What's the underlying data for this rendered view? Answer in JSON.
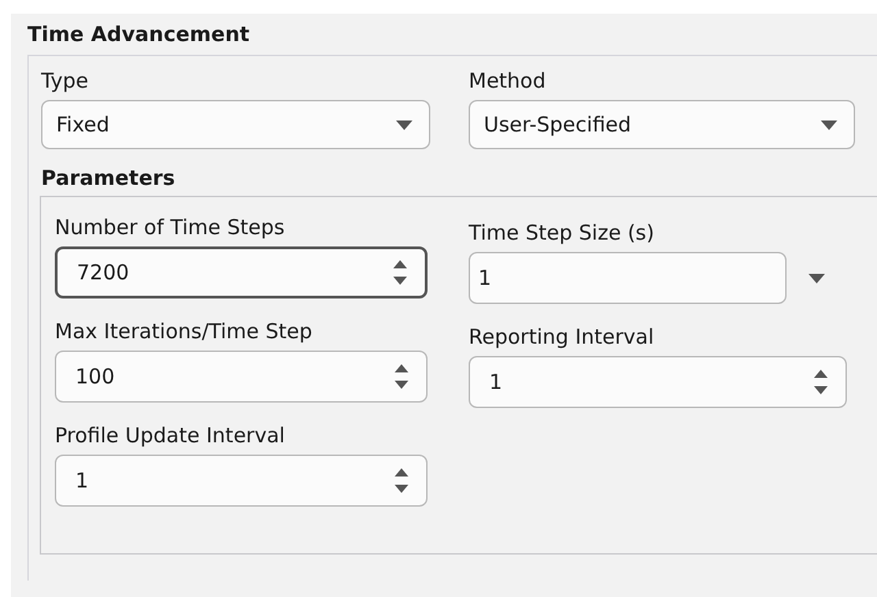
{
  "section": {
    "title": "Time Advancement"
  },
  "selectors": [
    {
      "label": "Type",
      "value": "Fixed"
    },
    {
      "label": "Method",
      "value": "User-Specified"
    }
  ],
  "parameters": {
    "title": "Parameters",
    "fields": [
      {
        "label": "Number of Time Steps",
        "value": "7200",
        "kind": "spin",
        "focused": true
      },
      {
        "label": "Time Step Size (s)",
        "value": "1",
        "kind": "unit",
        "focused": false
      },
      {
        "label": "Max Iterations/Time Step",
        "value": "100",
        "kind": "spin",
        "focused": false
      },
      {
        "label": "Reporting Interval",
        "value": "1",
        "kind": "spin",
        "focused": false
      },
      {
        "label": "Profile Update Interval",
        "value": "1",
        "kind": "spin",
        "focused": false
      }
    ]
  }
}
